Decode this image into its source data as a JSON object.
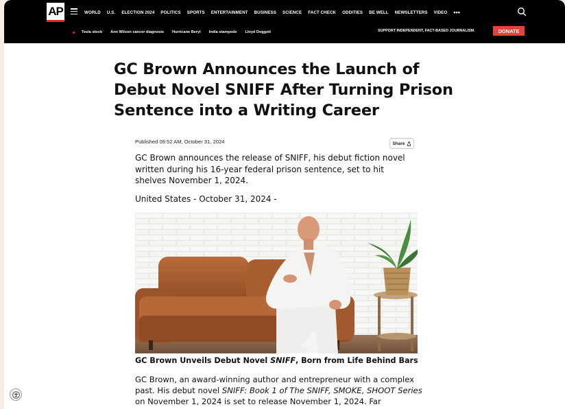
{
  "header": {
    "logo": "AP",
    "nav": [
      "WORLD",
      "U.S.",
      "ELECTION 2024",
      "POLITICS",
      "SPORTS",
      "ENTERTAINMENT",
      "BUSINESS",
      "SCIENCE",
      "FACT CHECK",
      "ODDITIES",
      "BE WELL",
      "NEWSLETTERS",
      "VIDEO"
    ],
    "more": "•••",
    "trending": [
      "Tesla stock",
      "Ann Wilson cancer diagnosis",
      "Hurricane Beryl",
      "India stampede",
      "Lloyd Doggett"
    ],
    "support_text": "SUPPORT INDEPENDENT, FACT-BASED JOURNALISM.",
    "donate_label": "DONATE",
    "accent_color": "#e8433a"
  },
  "article": {
    "headline": "GC Brown Announces the Launch of Debut Novel SNIFF After Turning Prison Sentence into a Writing Career",
    "published": "Published 09:52 AM, October 31, 2024",
    "share_label": "Share",
    "summary": "GC Brown announces the release of SNIFF, his debut fiction novel written during his 16-year federal prison sentence, set to hit shelves November 1, 2024.",
    "dateline": "United States - October 31, 2024 -",
    "caption_before": "GC Brown Unveils Debut Novel ",
    "caption_italic": "SNIFF",
    "caption_after": ", Born from Life Behind Bars",
    "body_1": "GC Brown, an award-winning author and entrepreneur with a complex past. His debut novel ",
    "body_italic": "SNIFF: Book 1 of The SNIFF, SMOKE, SHOOT Series",
    "body_2": " on November 1, 2024 is set to release November 1, 2024. Far"
  }
}
